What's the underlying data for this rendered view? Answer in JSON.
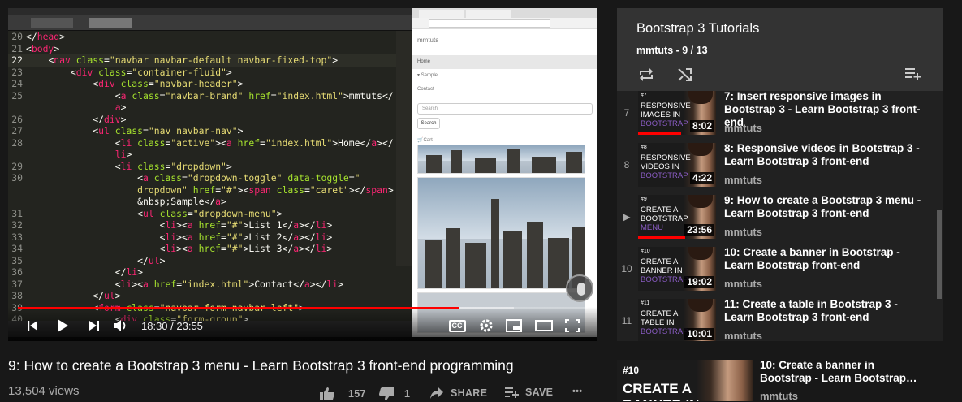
{
  "video": {
    "current_time": "18:30",
    "duration": "23:55",
    "time_display": "18:30 / 23:55",
    "played_fraction": 0.7735,
    "buffered_fraction": 0.87,
    "controls": [
      "previous-icon",
      "play-icon",
      "next-icon",
      "volume-icon",
      "captions-icon",
      "settings-icon",
      "miniplayer-icon",
      "theater-icon",
      "fullscreen-icon"
    ],
    "captions_label": "CC"
  },
  "editor": {
    "lines": [
      {
        "n": "20",
        "html": "<span class='p'>&lt;/</span><span class='t'>head</span><span class='p'>&gt;</span>"
      },
      {
        "n": "21",
        "html": "<span class='p'>&lt;</span><span class='t'>body</span><span class='p'>&gt;</span>"
      },
      {
        "n": "22",
        "cur": true,
        "html": "    <span class='p'>&lt;</span><span class='t'>nav</span> <span class='a'>class</span>=<span class='s'>\"navbar navbar-default navbar-fixed-top\"</span><span class='p'>&gt;</span>"
      },
      {
        "n": "23",
        "html": "        <span class='p'>&lt;</span><span class='t'>div</span> <span class='a'>class</span>=<span class='s'>\"container-fluid\"</span><span class='p'>&gt;</span>"
      },
      {
        "n": "24",
        "html": "            <span class='p'>&lt;</span><span class='t'>div</span> <span class='a'>class</span>=<span class='s'>\"navbar-header\"</span><span class='p'>&gt;</span>"
      },
      {
        "n": "25",
        "html": "                <span class='p'>&lt;</span><span class='t'>a</span> <span class='a'>class</span>=<span class='s'>\"navbar-brand\"</span> <span class='a'>href</span>=<span class='s'>\"index.html\"</span><span class='p'>&gt;mmtuts&lt;/</span>"
      },
      {
        "n": "",
        "html": "                <span class='t'>a</span><span class='p'>&gt;</span>"
      },
      {
        "n": "26",
        "html": "            <span class='p'>&lt;/</span><span class='t'>div</span><span class='p'>&gt;</span>"
      },
      {
        "n": "27",
        "html": "            <span class='p'>&lt;</span><span class='t'>ul</span> <span class='a'>class</span>=<span class='s'>\"nav navbar-nav\"</span><span class='p'>&gt;</span>"
      },
      {
        "n": "28",
        "html": "                <span class='p'>&lt;</span><span class='t'>li</span> <span class='a'>class</span>=<span class='s'>\"active\"</span><span class='p'>&gt;&lt;</span><span class='t'>a</span> <span class='a'>href</span>=<span class='s'>\"index.html\"</span><span class='p'>&gt;Home&lt;/</span><span class='t'>a</span><span class='p'>&gt;&lt;/</span>"
      },
      {
        "n": "",
        "html": "                <span class='t'>li</span><span class='p'>&gt;</span>"
      },
      {
        "n": "29",
        "html": "                <span class='p'>&lt;</span><span class='t'>li</span> <span class='a'>class</span>=<span class='s'>\"dropdown\"</span><span class='p'>&gt;</span>"
      },
      {
        "n": "30",
        "html": "                    <span class='p'>&lt;</span><span class='t'>a</span> <span class='a'>class</span>=<span class='s'>\"dropdown-toggle\"</span> <span class='a'>data-toggle</span>=<span class='s'>\"</span>"
      },
      {
        "n": "",
        "html": "                    <span class='s'>dropdown\"</span> <span class='a'>href</span>=<span class='s'>\"#\"</span><span class='p'>&gt;&lt;</span><span class='t'>span</span> <span class='a'>class</span>=<span class='s'>\"caret\"</span><span class='p'>&gt;&lt;/</span><span class='t'>span</span><span class='p'>&gt;</span>"
      },
      {
        "n": "",
        "html": "                    <span class='p'>&amp;nbsp;Sample&lt;/</span><span class='t'>a</span><span class='p'>&gt;</span>"
      },
      {
        "n": "31",
        "html": "                    <span class='p'>&lt;</span><span class='t'>ul</span> <span class='a'>class</span>=<span class='s'>\"dropdown-menu\"</span><span class='p'>&gt;</span>"
      },
      {
        "n": "32",
        "html": "                        <span class='p'>&lt;</span><span class='t'>li</span><span class='p'>&gt;&lt;</span><span class='t'>a</span> <span class='a'>href</span>=<span class='s'>\"#\"</span><span class='p'>&gt;List 1&lt;/</span><span class='t'>a</span><span class='p'>&gt;&lt;/</span><span class='t'>li</span><span class='p'>&gt;</span>"
      },
      {
        "n": "33",
        "html": "                        <span class='p'>&lt;</span><span class='t'>li</span><span class='p'>&gt;&lt;</span><span class='t'>a</span> <span class='a'>href</span>=<span class='s'>\"#\"</span><span class='p'>&gt;List 2&lt;/</span><span class='t'>a</span><span class='p'>&gt;&lt;/</span><span class='t'>li</span><span class='p'>&gt;</span>"
      },
      {
        "n": "34",
        "html": "                        <span class='p'>&lt;</span><span class='t'>li</span><span class='p'>&gt;&lt;</span><span class='t'>a</span> <span class='a'>href</span>=<span class='s'>\"#\"</span><span class='p'>&gt;List 3&lt;/</span><span class='t'>a</span><span class='p'>&gt;&lt;/</span><span class='t'>li</span><span class='p'>&gt;</span>"
      },
      {
        "n": "35",
        "html": "                    <span class='p'>&lt;/</span><span class='t'>ul</span><span class='p'>&gt;</span>"
      },
      {
        "n": "36",
        "html": "                <span class='p'>&lt;/</span><span class='t'>li</span><span class='p'>&gt;</span>"
      },
      {
        "n": "37",
        "html": "                <span class='p'>&lt;</span><span class='t'>li</span><span class='p'>&gt;&lt;</span><span class='t'>a</span> <span class='a'>href</span>=<span class='s'>\"index.html\"</span><span class='p'>&gt;Contact&lt;/</span><span class='t'>a</span><span class='p'>&gt;&lt;/</span><span class='t'>li</span><span class='p'>&gt;</span>"
      },
      {
        "n": "38",
        "html": "            <span class='p'>&lt;/</span><span class='t'>ul</span><span class='p'>&gt;</span>"
      },
      {
        "n": "39",
        "html": "            <span class='p'>&lt;</span><span class='t'>form</span> <span class='a'>class</span>=<span class='s'>\"navbar-form navbar-left\"</span><span class='p'>&gt;</span>"
      },
      {
        "n": "40",
        "html": "                <span class='p'>&lt;</span><span class='t'>div</span> <span class='a'>class</span>=<span class='s'>\"form-group\"</span><span class='p'>&gt;</span>"
      }
    ]
  },
  "preview": {
    "brand": "mmtuts",
    "nav": [
      "Home",
      "▾ Sample",
      "Contact"
    ],
    "search_placeholder": "Search",
    "search_button": "Search",
    "cart": "🛒Cart"
  },
  "title": "9: How to create a Bootstrap 3 menu - Learn Bootstrap 3 front-end programming",
  "views": "13,504 views",
  "actions": {
    "likes": "157",
    "dislikes": "1",
    "share": "SHARE",
    "save": "SAVE",
    "more": "•••"
  },
  "playlist": {
    "title": "Bootstrap 3 Tutorials",
    "subtitle": "mmtuts - 9 / 13",
    "items": [
      {
        "index": "7",
        "num": "#7",
        "l1": "RESPONSIVE",
        "l2": "IMAGES IN",
        "l3": "BOOTSTRAP",
        "duration": "8:02",
        "title": "7: Insert responsive images in Bootstrap 3 - Learn Bootstrap 3 front-end",
        "channel": "mmtuts",
        "watched": 0.55
      },
      {
        "index": "8",
        "num": "#8",
        "l1": "RESPONSIVE",
        "l2": "VIDEOS IN",
        "l3": "BOOTSTRAP",
        "duration": "4:22",
        "title": "8: Responsive videos in Bootstrap 3 - Learn Bootstrap 3 front-end",
        "channel": "mmtuts",
        "watched": 0
      },
      {
        "index": "▶",
        "num": "#9",
        "l1": "CREATE A",
        "l2": "BOOTSTRAP",
        "l3": "MENU",
        "duration": "23:56",
        "title": "9: How to create a Bootstrap 3 menu - Learn Bootstrap 3 front-end",
        "channel": "mmtuts",
        "watched": 0.6
      },
      {
        "index": "10",
        "num": "#10",
        "l1": "CREATE A",
        "l2": "BANNER IN",
        "l3": "BOOTSTRAP",
        "duration": "19:02",
        "title": "10: Create a banner in Bootstrap - Learn Bootstrap front-end",
        "channel": "mmtuts",
        "watched": 0
      },
      {
        "index": "11",
        "num": "#11",
        "l1": "CREATE A",
        "l2": "TABLE IN",
        "l3": "BOOTSTRAP",
        "duration": "10:01",
        "title": "11: Create a table in Bootstrap 3 - Learn Bootstrap 3 front-end",
        "channel": "mmtuts",
        "watched": 0
      }
    ]
  },
  "up_next": {
    "num": "#10",
    "thumb_text": "CREATE A\nBANNER IN",
    "title": "10: Create a banner in Bootstrap - Learn Bootstrap…",
    "channel": "mmtuts"
  }
}
